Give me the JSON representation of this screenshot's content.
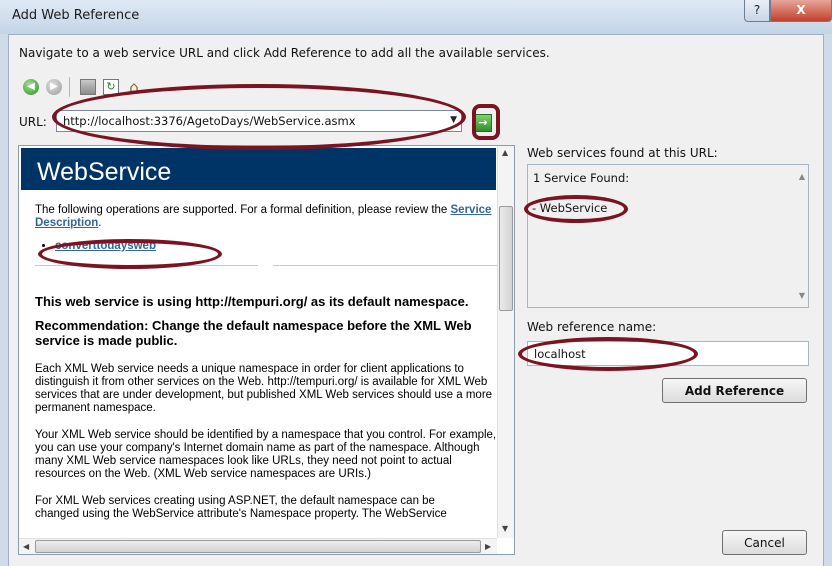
{
  "window": {
    "title": "Add Web Reference",
    "help_label": "?",
    "close_label": "X"
  },
  "instruction": "Navigate to a web service URL and click Add Reference to add all the available services.",
  "toolbar": {
    "back_icon": "back-arrow-icon",
    "forward_icon": "forward-arrow-icon",
    "stop_icon": "stop-icon",
    "refresh_icon": "refresh-icon",
    "home_icon": "home-icon",
    "back_glyph": "◀",
    "forward_glyph": "▶",
    "refresh_glyph": "↻",
    "home_glyph": "⌂"
  },
  "url": {
    "label": "URL:",
    "value": "http://localhost:3376/AgetoDays/WebService.asmx",
    "dropdown_glyph": "▼",
    "go_glyph": "→"
  },
  "browser": {
    "service_name": "WebService",
    "intro_line": "The following operations are supported. For a formal definition, please review the",
    "service_description_link": "Service Description",
    "period": ".",
    "operations": [
      "converttodaysweb"
    ],
    "namespace_heading": "This web service is using http://tempuri.org/ as its default namespace.",
    "recommendation_heading": "Recommendation: Change the default namespace before the XML Web service is made public.",
    "paragraph_1": "Each XML Web service needs a unique namespace in order for client applications to distinguish it from other services on the Web. http://tempuri.org/ is available for XML Web services that are under development, but published XML Web services should use a more permanent namespace.",
    "paragraph_2": "Your XML Web service should be identified by a namespace that you control. For example, you can use your company's Internet domain name as part of the namespace. Although many XML Web service namespaces look like URLs, they need not point to actual resources on the Web. (XML Web service namespaces are URIs.)",
    "paragraph_3": "For XML Web services creating using ASP.NET, the default namespace can be",
    "paragraph_3_cut": "changed using the WebService attribute's Namespace property. The WebService",
    "scroll_up_glyph": "▲",
    "scroll_down_glyph": "▼",
    "scroll_left_glyph": "◀",
    "scroll_right_glyph": "▶"
  },
  "services": {
    "label": "Web services found at this URL:",
    "count_text": "1 Service Found:",
    "items": [
      "- WebService"
    ],
    "scroll_up_glyph": "▲",
    "scroll_down_glyph": "▼"
  },
  "reference": {
    "label": "Web reference name:",
    "value": "localhost",
    "add_button": "Add Reference",
    "cancel_button": "Cancel"
  },
  "colors": {
    "highlight": "#7b1422",
    "service_header": "#003366",
    "link": "#336699"
  }
}
